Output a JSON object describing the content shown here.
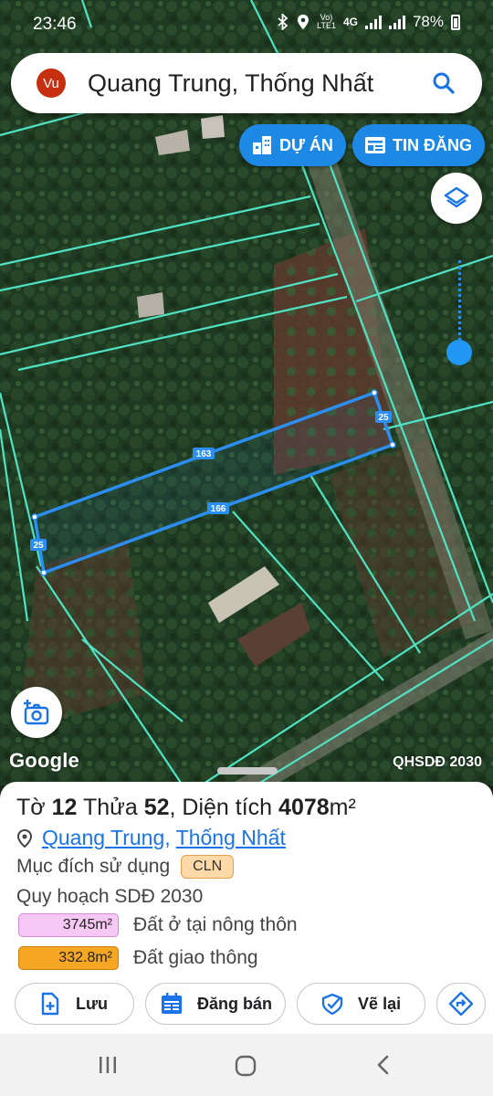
{
  "status_bar": {
    "time": "23:46",
    "network_label_top": "Vo)",
    "network_label_bottom": "LTE1",
    "network_type": "4G",
    "battery": "78%"
  },
  "search": {
    "avatar_initials": "Vu",
    "query": "Quang Trung, Thống Nhất",
    "icon": "search-icon"
  },
  "map_buttons": {
    "du_an": "DỰ ÁN",
    "tin_dang": "TIN ĐĂNG"
  },
  "map": {
    "edge_labels": [
      "163",
      "25",
      "166",
      "25"
    ],
    "google_label": "Google",
    "overlay_label": "QHSDĐ 2030",
    "boundary_color": "#2b8ef0",
    "parcel_line_color": "#4fe3c4"
  },
  "parcel": {
    "to_label": "Tờ",
    "to_value": "12",
    "thua_label": "Thửa",
    "thua_value": "52",
    "area_label": ", Diện tích",
    "area_value": "4078",
    "area_unit": "m²",
    "commune": "Quang Trung",
    "district": "Thống Nhất",
    "purpose_label": "Mục đích sử dụng",
    "purpose_code": "CLN",
    "plan_label": "Quy hoạch SDĐ 2030",
    "land_uses": [
      {
        "area": "3745m²",
        "name": "Đất ở tại nông thôn",
        "color": "#f7c8f5"
      },
      {
        "area": "332.8m²",
        "name": "Đất giao thông",
        "color": "#f5a623"
      }
    ]
  },
  "actions": {
    "save": "Lưu",
    "sell": "Đăng bán",
    "redraw": "Vẽ lại"
  }
}
